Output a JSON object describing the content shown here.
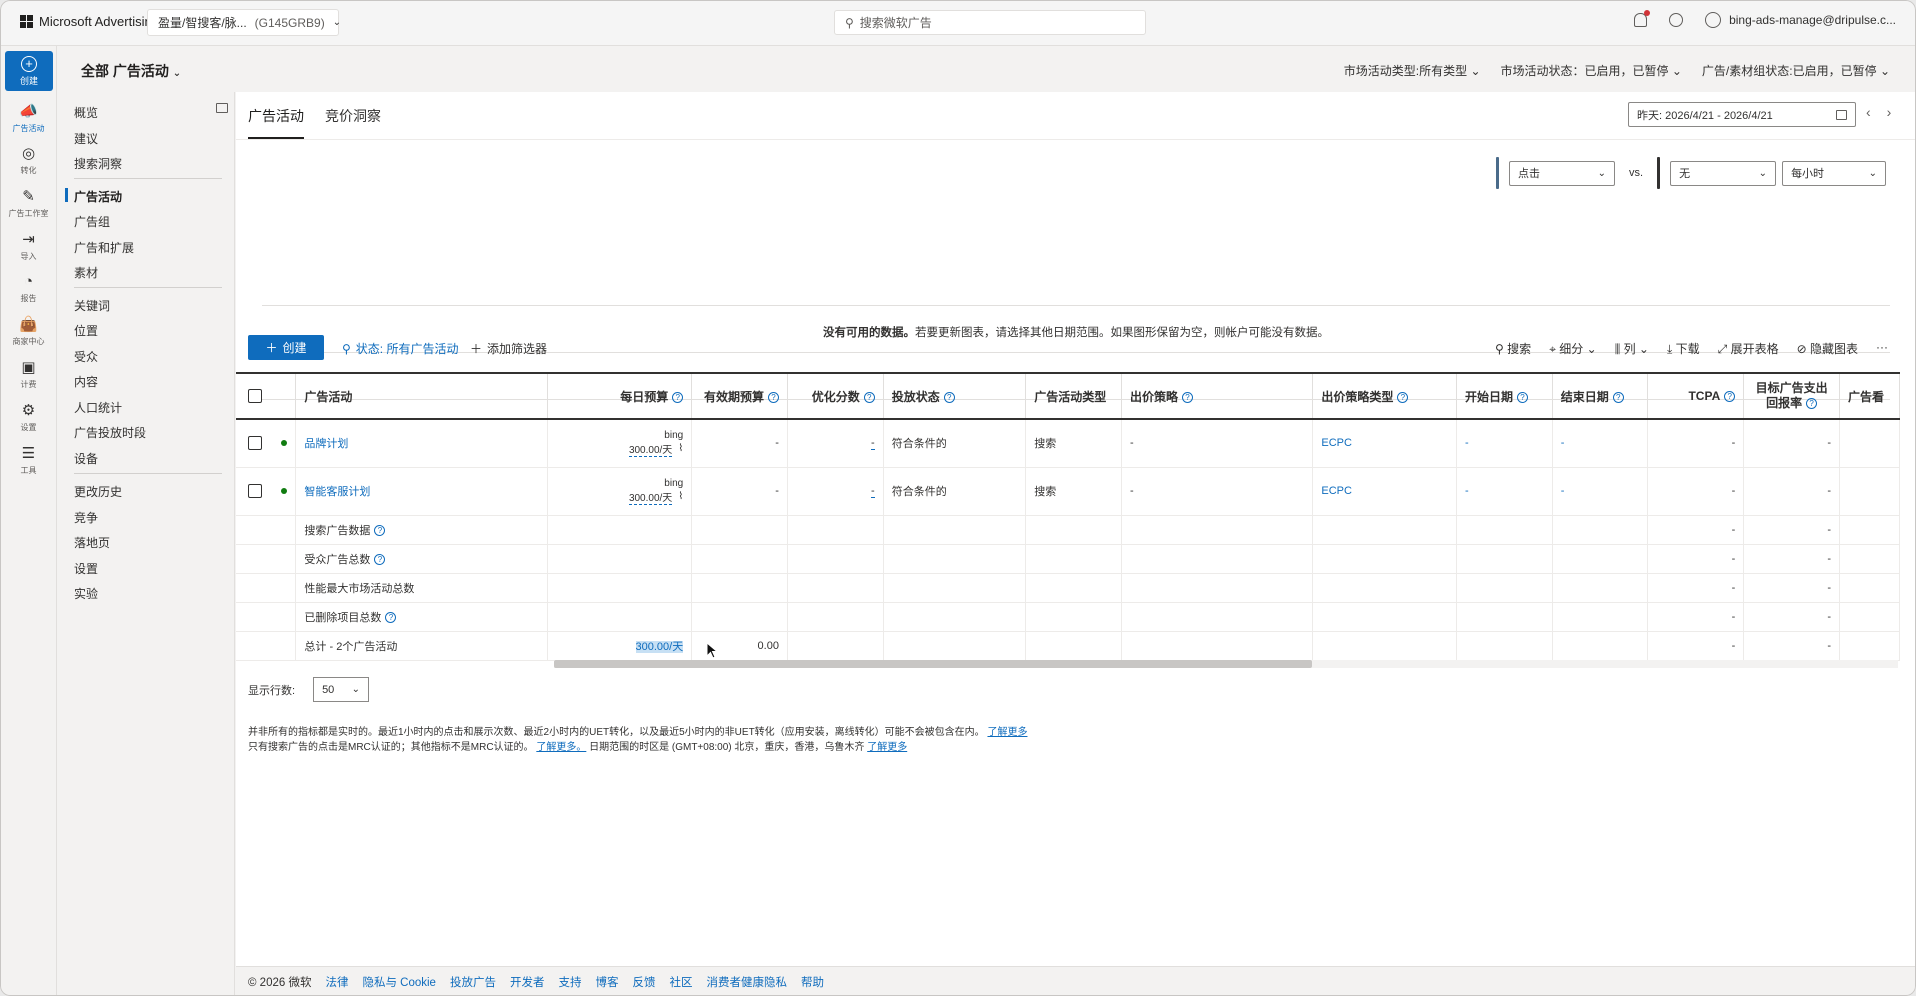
{
  "topbar": {
    "brand": "Microsoft Advertising",
    "account_name": "盈量/智搜客/脉...",
    "account_id": "(G145GRB9)",
    "search_placeholder": "搜索微软广告",
    "user": "bing-ads-manage@dripulse.c..."
  },
  "rail": {
    "create": "创建",
    "items": [
      "广告活动",
      "转化",
      "广告工作室",
      "导入",
      "报告",
      "商家中心",
      "计费",
      "设置",
      "工具"
    ]
  },
  "subheader": {
    "scope": "全部 广告活动",
    "filters": [
      "市场活动类型:所有类型",
      "市场活动状态：已启用，已暂停",
      "广告/素材组状态:已启用，已暂停"
    ]
  },
  "leftnav": {
    "groups": [
      [
        "概览",
        "建议",
        "搜索洞察"
      ],
      [
        "广告活动",
        "广告组",
        "广告和扩展",
        "素材"
      ],
      [
        "关键词",
        "位置",
        "受众",
        "内容",
        "人口统计",
        "广告投放时段",
        "设备"
      ],
      [
        "更改历史",
        "竞争",
        "落地页",
        "设置",
        "实验"
      ]
    ],
    "active": "广告活动"
  },
  "tabs": {
    "campaigns": "广告活动",
    "auction": "竞价洞察"
  },
  "date": {
    "range": "昨天: 2026/4/21 - 2026/4/21"
  },
  "chart": {
    "metric1": "点击",
    "vs": "vs.",
    "metric2": "无",
    "granularity": "每小时",
    "nodata_bold": "没有可用的数据。",
    "nodata_rest": "若要更新图表，请选择其他日期范围。如果图形保留为空，则帐户可能没有数据。"
  },
  "toolbar": {
    "create": "创建",
    "status_filter": "状态: 所有广告活动",
    "add_filter": "添加筛选器",
    "right": [
      "搜索",
      "细分",
      "列",
      "下载",
      "展开表格",
      "隐藏图表",
      "···"
    ]
  },
  "table": {
    "headers": [
      "广告活动",
      "每日预算",
      "有效期预算",
      "优化分数",
      "投放状态",
      "广告活动类型",
      "出价策略",
      "出价策略类型",
      "开始日期",
      "结束日期",
      "TCPA",
      "目标广告支出回报率",
      "广告看"
    ],
    "rows": [
      {
        "name": "品牌计划",
        "budget_src": "bing",
        "budget": "300.00/天",
        "lifetime": "-",
        "opt": "-",
        "status": "符合条件的",
        "type": "搜索",
        "strategy": "-",
        "strategy_type": "ECPC",
        "start": "-",
        "end": "-",
        "tcpa": "-",
        "troas": "-"
      },
      {
        "name": "智能客服计划",
        "budget_src": "bing",
        "budget": "300.00/天",
        "lifetime": "-",
        "opt": "-",
        "status": "符合条件的",
        "type": "搜索",
        "strategy": "-",
        "strategy_type": "ECPC",
        "start": "-",
        "end": "-",
        "tcpa": "-",
        "troas": "-"
      }
    ],
    "summary": [
      {
        "label": "搜索广告数据",
        "help": true,
        "tcpa": "-",
        "troas": "-"
      },
      {
        "label": "受众广告总数",
        "help": true,
        "tcpa": "-",
        "troas": "-"
      },
      {
        "label": "性能最大市场活动总数",
        "help": false,
        "tcpa": "-",
        "troas": "-"
      },
      {
        "label": "已删除项目总数",
        "help": true,
        "tcpa": "-",
        "troas": "-"
      }
    ],
    "total": {
      "label": "总计 - 2个广告活动",
      "budget": "300.00/天",
      "lifetime": "0.00",
      "tcpa": "-",
      "troas": "-"
    }
  },
  "rows_control": {
    "label": "显示行数:",
    "value": "50"
  },
  "notes": {
    "line1": "并非所有的指标都是实时的。最近1小时内的点击和展示次数、最近2小时内的UET转化，以及最近5小时内的非UET转化（应用安装，离线转化）可能不会被包含在内。",
    "learn1": "了解更多",
    "line2a": "只有搜索广告的点击是MRC认证的；其他指标不是MRC认证的。",
    "learn2": "了解更多。",
    "line2b": "日期范围的时区是 (GMT+08:00) 北京，重庆，香港，乌鲁木齐",
    "learn3": "了解更多"
  },
  "footer": {
    "copyright": "© 2026 微软",
    "links": [
      "法律",
      "隐私与 Cookie",
      "投放广告",
      "开发者",
      "支持",
      "博客",
      "反馈",
      "社区",
      "消费者健康隐私",
      "帮助"
    ]
  }
}
